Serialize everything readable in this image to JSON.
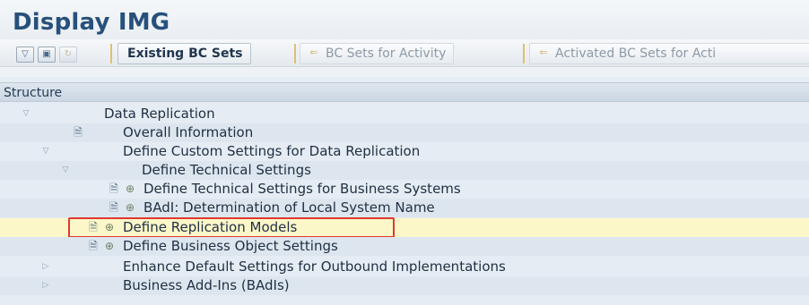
{
  "window": {
    "title": "Display IMG"
  },
  "toolbar": {
    "icons": [
      "expand-icon",
      "save-icon",
      "transport-icon"
    ],
    "buttons": [
      {
        "label": "Existing BC Sets",
        "enabled": true
      },
      {
        "label": "BC Sets for Activity",
        "enabled": false
      },
      {
        "label": "Activated BC Sets for Acti",
        "enabled": false
      }
    ]
  },
  "structure": {
    "header": "Structure",
    "nodes": [
      {
        "label": "Data Replication",
        "level": 0,
        "expanded": true
      },
      {
        "label": "Overall Information",
        "level": 1,
        "icons": [
          "document-icon"
        ]
      },
      {
        "label": "Define Custom Settings for Data Replication",
        "level": 1,
        "expanded": true
      },
      {
        "label": "Define Technical Settings",
        "level": 2,
        "expanded": true
      },
      {
        "label": "Define Technical Settings for Business Systems",
        "level": 3,
        "icons": [
          "document-icon",
          "execute-icon"
        ]
      },
      {
        "label": "BAdI: Determination of Local System Name",
        "level": 3,
        "icons": [
          "document-icon",
          "execute-icon"
        ]
      },
      {
        "label": "Define Replication Models",
        "level": 2,
        "icons": [
          "document-icon",
          "execute-icon"
        ],
        "highlighted": true
      },
      {
        "label": "Define Business Object Settings",
        "level": 2,
        "icons": [
          "document-icon",
          "execute-icon"
        ]
      },
      {
        "label": "Enhance Default Settings for Outbound Implementations",
        "level": 1,
        "expanded": false
      },
      {
        "label": "Business Add-Ins (BAdIs)",
        "level": 1,
        "expanded": false
      }
    ]
  },
  "colors": {
    "title": "#27507c",
    "highlight": "#fbf7c9",
    "marker": "#e0382f"
  }
}
